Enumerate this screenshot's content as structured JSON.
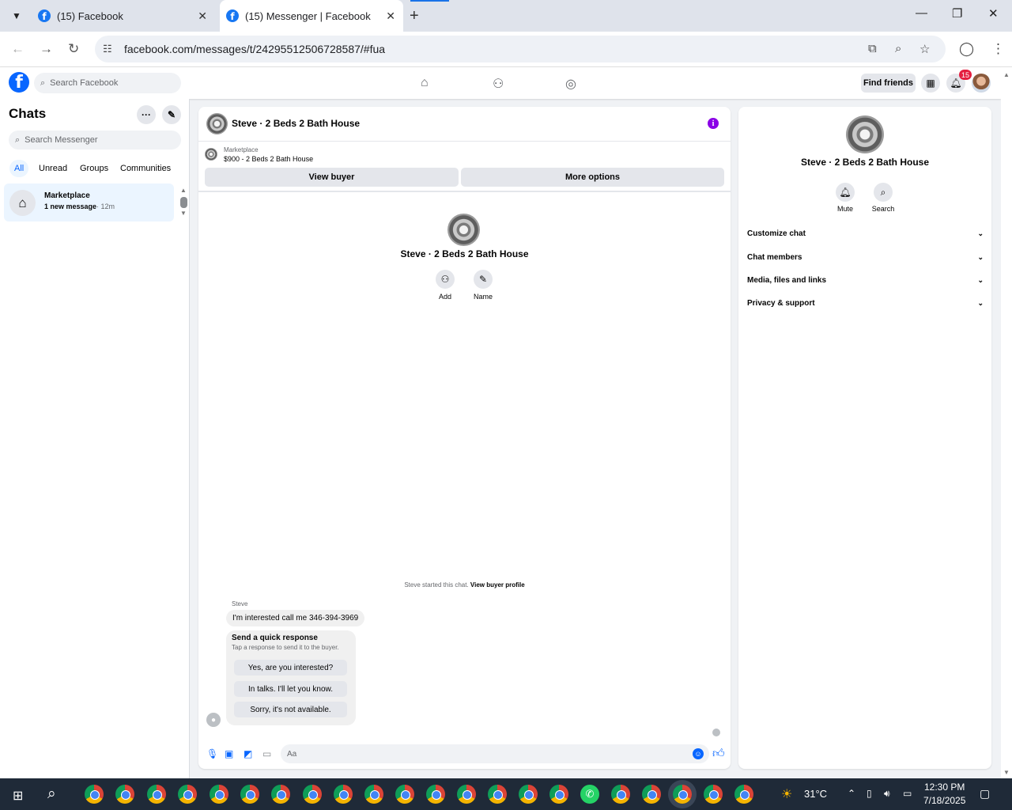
{
  "browser": {
    "tabs": [
      {
        "title": "(15) Facebook"
      },
      {
        "title": "(15) Messenger | Facebook"
      }
    ],
    "url": "facebook.com/messages/t/24295512506728587/#fua",
    "new_tab_icon": "+",
    "tab_list_icon": "chevron-down"
  },
  "fb_header": {
    "search_placeholder": "Search Facebook",
    "find_friends": "Find friends",
    "notification_count": "15",
    "brand_color": "#0866ff"
  },
  "chats_panel": {
    "title": "Chats",
    "search_placeholder": "Search Messenger",
    "filters": [
      "All",
      "Unread",
      "Groups",
      "Communities"
    ],
    "active_filter": "All",
    "items": [
      {
        "name": "Marketplace",
        "preview": "1 new message",
        "time": "· 12m"
      }
    ]
  },
  "conversation": {
    "title": "Steve · 2 Beds 2 Bath House",
    "listing_label": "Marketplace",
    "listing_title": "$900 - 2 Beds 2 Bath House",
    "view_buyer": "View buyer",
    "more_options": "More options",
    "profile_name": "Steve · 2 Beds 2 Bath House",
    "add_label": "Add",
    "name_label": "Name",
    "started_text": "Steve started this chat.",
    "view_buyer_profile": "View buyer profile",
    "sender": "Steve",
    "message": "I'm interested call me 346-394-3969",
    "quick_response": {
      "title": "Send a quick response",
      "subtitle": "Tap a response to send it to the buyer.",
      "options": [
        "Yes, are you interested?",
        "In talks. I'll let you know.",
        "Sorry, it's not available."
      ]
    },
    "composer_placeholder": "Aa"
  },
  "details_panel": {
    "name": "Steve · 2 Beds 2 Bath House",
    "mute_label": "Mute",
    "search_label": "Search",
    "sections": [
      "Customize chat",
      "Chat members",
      "Media, files and links",
      "Privacy & support"
    ]
  },
  "taskbar": {
    "temperature": "31°C",
    "time": "12:30 PM",
    "date": "7/18/2025"
  }
}
